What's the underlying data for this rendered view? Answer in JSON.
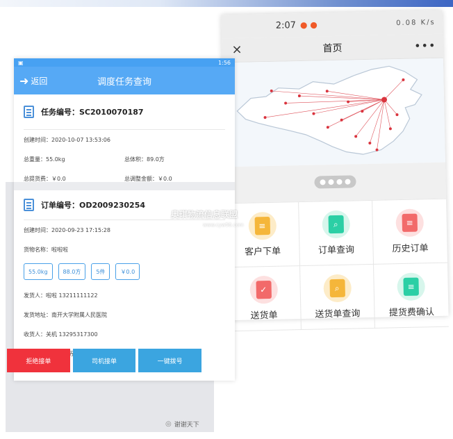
{
  "right_phone": {
    "status_time": "2:07",
    "status_icons": "0.08 K/s",
    "title": "首页",
    "close_icon": "×",
    "more_icon": "•••",
    "menu": [
      {
        "label": "客户下单",
        "icon": "order-form-icon",
        "color": "#f5b63a",
        "bg": "#fdecc8"
      },
      {
        "label": "订单查询",
        "icon": "order-search-icon",
        "color": "#2bcfa5",
        "bg": "#d7f6ec"
      },
      {
        "label": "历史订单",
        "icon": "history-order-icon",
        "color": "#f26a6a",
        "bg": "#fde0e0"
      },
      {
        "label": "送货单",
        "icon": "delivery-note-icon",
        "color": "#f26a6a",
        "bg": "#fde0e0"
      },
      {
        "label": "送货单查询",
        "icon": "delivery-search-icon",
        "color": "#f5b63a",
        "bg": "#fdecc8"
      },
      {
        "label": "提货费确认",
        "icon": "fee-confirm-icon",
        "color": "#2bcfa5",
        "bg": "#d7f6ec"
      }
    ]
  },
  "left_phone": {
    "status_clock": "1:56",
    "back_label": "返回",
    "title": "调度任务查询",
    "task_no": "任务编号：SC2010070187",
    "created": "创建时间：2020-10-07 13:53:06",
    "total_weight": "总重量：55.0kg",
    "total_volume": "总体积：89.0方",
    "total_pickup_fee": "总提货费：￥0.0",
    "total_adjust": "总调整金额：￥0.0",
    "order_no": "订单编号：OD2009230254",
    "order_created": "创建时间：2020-09-23 17:15:28",
    "goods_name": "货物名称：啦啦啦",
    "chips": [
      "55.0kg",
      "88.0方",
      "5件",
      "￥0.0"
    ],
    "shipper": "发货人：啦啦  13211111122",
    "ship_address": "发货地址：南开大学附属人民医院",
    "receiver": "收货人：关机  13295317300",
    "receive_address": "收货地址：济南市历下区力高国际",
    "buttons": [
      "拒绝接单",
      "司机接单",
      "一键拨号"
    ]
  },
  "watermark": "奥琪物流信息联盟",
  "watermark_sub": "www.cyw56.com",
  "brand": "谢谢天下"
}
